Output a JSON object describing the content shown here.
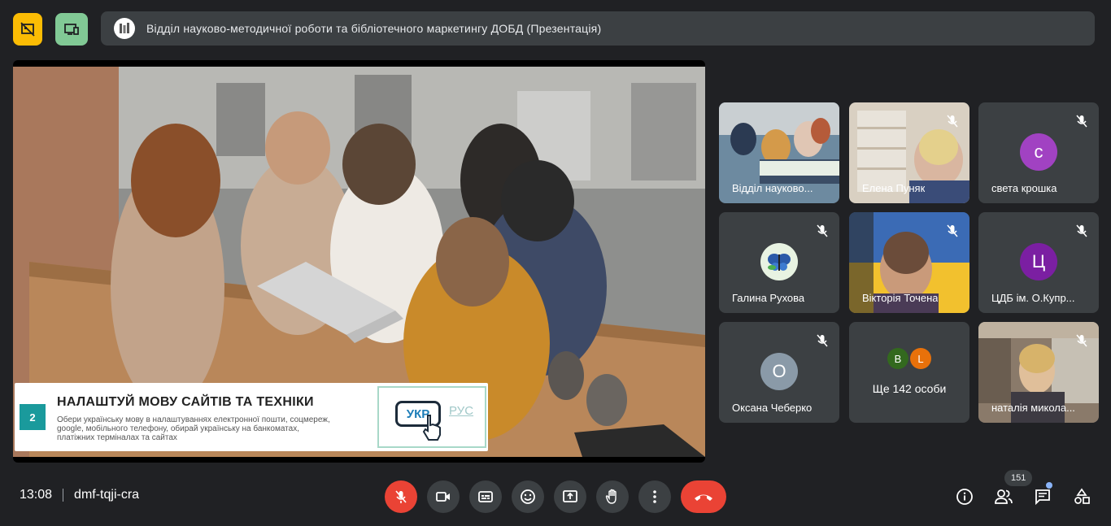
{
  "presentation": {
    "title": "Відділ науково-методичної роботи та бібліотечного маркетингу ДОБД (Презентація)"
  },
  "slide": {
    "number": "2",
    "heading": "НАЛАШТУЙ МОВУ САЙТІВ ТА ТЕХНІКИ",
    "description": "Обери українську мову в налаштуваннях електронної пошти, соцмереж, google, мобільного телефону, обирай українську на банкоматах, платіжних терміналах та сайтах",
    "lang_selected": "УКР",
    "lang_other": "РУС"
  },
  "participants": [
    {
      "name": "Відділ науково...",
      "type": "video"
    },
    {
      "name": "Елена Пуняк",
      "type": "video"
    },
    {
      "name": "света крошка",
      "type": "avatar",
      "initial": "с",
      "color": "#a142c2"
    },
    {
      "name": "Галина Рухова",
      "type": "image-avatar"
    },
    {
      "name": "Вікторія Точена",
      "type": "video"
    },
    {
      "name": "ЦДБ ім. О.Купр...",
      "type": "avatar",
      "initial": "Ц",
      "color": "#7b1fa2"
    },
    {
      "name": "Оксана Чеберко",
      "type": "avatar",
      "initial": "О",
      "color": "#8a9aa8"
    },
    {
      "name": "наталія микола...",
      "type": "video"
    }
  ],
  "more_tile": {
    "initials": [
      {
        "letter": "B",
        "color": "#33691e"
      },
      {
        "letter": "L",
        "color": "#e8710a"
      }
    ],
    "label": "Ще 142 особи"
  },
  "meeting": {
    "time": "13:08",
    "code": "dmf-tqji-cra",
    "participant_count": "151"
  },
  "colors": {
    "background": "#202124",
    "surface": "#3c4043",
    "danger": "#ea4335",
    "accent_yellow": "#fbbc04",
    "accent_green": "#81c995"
  },
  "icons": {
    "top": [
      "no-present-icon",
      "present-screen-icon"
    ],
    "controls": [
      "mic-off-icon",
      "camera-icon",
      "captions-icon",
      "emoji-icon",
      "present-icon",
      "raise-hand-icon",
      "more-options-icon",
      "end-call-icon"
    ],
    "right": [
      "info-icon",
      "people-icon",
      "chat-icon",
      "activities-icon"
    ]
  }
}
